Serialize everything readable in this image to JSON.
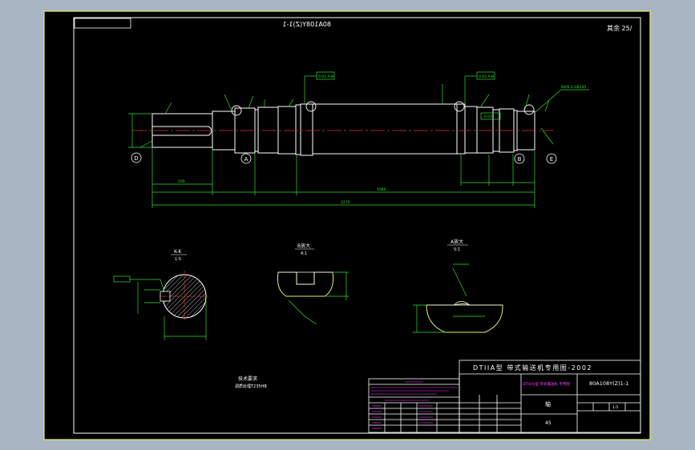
{
  "drawing": {
    "code_mirrored": "80A108Y(Z)1-1",
    "roughness_corner": "其余 25/"
  },
  "title_block": {
    "header": "DTIIA型 带式输送机专用图-2002",
    "drawing_code": "80A108Y(Z)1-1",
    "part_name": "轴",
    "material": "45",
    "spec_line": "DTII(A)型 带式输送机 专用图",
    "scale": "1:5"
  },
  "notes": {
    "heading": "技术要求",
    "line1": "调质处理T235HB"
  },
  "section_views": {
    "kk_label": "K-K",
    "kk_scale": "1:5",
    "b_label": "B放大",
    "b_scale": "4:1",
    "a_label": "A放大",
    "a_scale": "5:1"
  },
  "callouts": {
    "tol1": "0.02 A-B",
    "tol2": "0.02 A-B",
    "tol3": "0.03",
    "centering": "B4/6.3 GB145"
  },
  "datums": {
    "d": "D",
    "a": "A",
    "b": "B",
    "e": "E"
  },
  "dimensions": {
    "total_length": "2270",
    "middle_length": "1680",
    "left_segment": "200"
  }
}
